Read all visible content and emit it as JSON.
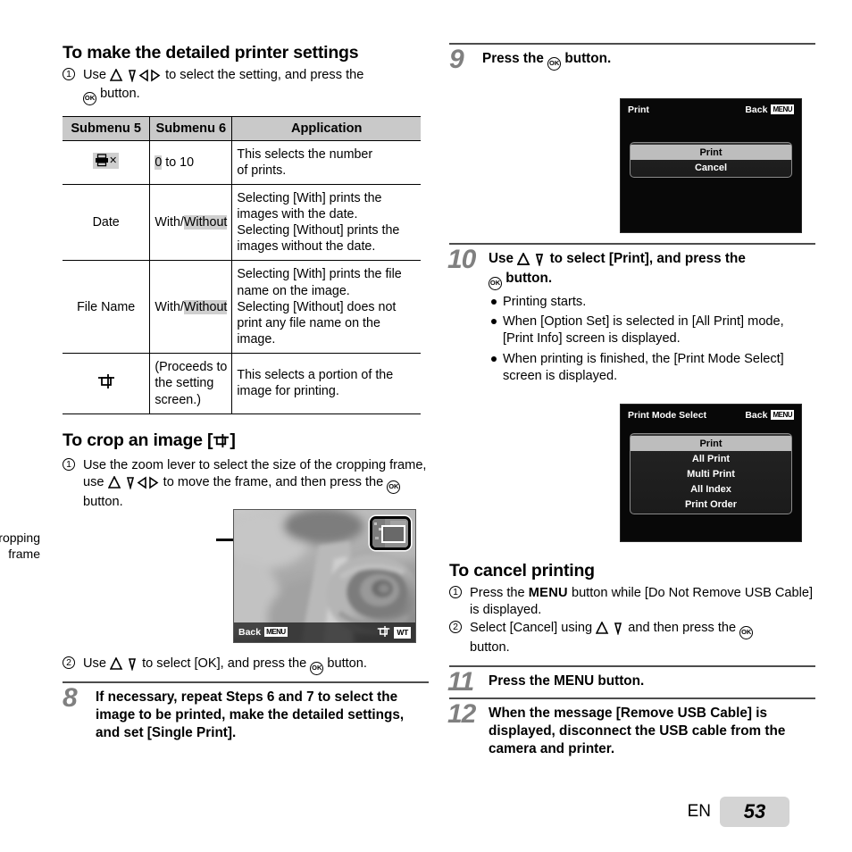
{
  "left": {
    "section1_title": "To make the detailed printer settings",
    "step1": {
      "pre": "Use",
      "post": "to select the setting, and press the",
      "tail": "button."
    },
    "table": {
      "headers": [
        "Submenu 5",
        "Submenu 6",
        "Application"
      ],
      "rows": [
        {
          "submenu5": "×",
          "submenu5_icon": "printer-icon",
          "submenu5_highlight": true,
          "submenu6_pre": "0",
          "submenu6_post": " to 10",
          "submenu6_highlight_part": "0",
          "application": "This selects the number\nof prints."
        },
        {
          "submenu5": "Date",
          "submenu6_pre": "With/",
          "submenu6_post": "Without",
          "submenu6_highlight_part": "Without",
          "application": "Selecting [With] prints the\nimages with the date.\nSelecting [Without] prints the\nimages without the date."
        },
        {
          "submenu5": "File Name",
          "submenu6_pre": "With/",
          "submenu6_post": "Without",
          "submenu6_highlight_part": "Without",
          "application": "Selecting [With] prints the file\nname on the image.\nSelecting [Without] does not\nprint any file name on the\nimage."
        },
        {
          "submenu5": "",
          "submenu5_icon": "crop-icon",
          "submenu6_pre": "(Proceeds to the setting screen.)",
          "submenu6_post": "",
          "submenu6_highlight_part": "",
          "application": "This selects a portion of the\nimage for printing."
        }
      ]
    },
    "section2_title_pre": "To crop an image [",
    "section2_title_post": "]",
    "crop_step1": {
      "pre": "Use the zoom lever to select the size of the cropping frame, use",
      "post": "to move the frame, and then press the",
      "tail": "button."
    },
    "figure": {
      "callout_line1": "Cropping",
      "callout_line2": "frame",
      "photo_back_label": "Back",
      "photo_back_badge": "MENU",
      "photo_wt_badge": "WT"
    },
    "crop_step2": {
      "pre": "Use",
      "post": "to select [OK], and press the",
      "tail": "button."
    },
    "step8": {
      "number": "8",
      "text": "If necessary, repeat Steps 6 and 7 to select the image to be printed, make the detailed settings, and set [Single Print]."
    }
  },
  "right": {
    "step9": {
      "number": "9",
      "pre": "Press the",
      "post": "button."
    },
    "lcd_print": {
      "title": "Print",
      "back_label": "Back",
      "back_badge": "MENU",
      "items": [
        "Print",
        "Cancel"
      ],
      "selected_index": 0
    },
    "step10": {
      "number": "10",
      "pre": "Use",
      "post": "to select [Print], and press the",
      "tail": "button.",
      "bullets": [
        "Printing starts.",
        "When [Option Set] is selected in [All Print] mode, [Print Info] screen is displayed.",
        "When printing is finished, the [Print Mode Select] screen is displayed."
      ]
    },
    "lcd_mode": {
      "title": "Print Mode Select",
      "back_label": "Back",
      "back_badge": "MENU",
      "items": [
        "Print",
        "All Print",
        "Multi Print",
        "All Index",
        "Print Order"
      ],
      "selected_index": 0
    },
    "cancel_title": "To cancel printing",
    "cancel_step1": {
      "pre": "Press the",
      "menu": "MENU",
      "post": "button while [Do Not Remove USB Cable]  is displayed."
    },
    "cancel_step2": {
      "pre": "Select [Cancel] using",
      "post": "and then press the",
      "tail": "button."
    },
    "step11": {
      "number": "11",
      "pre": "Press the",
      "menu": "MENU",
      "post": "button."
    },
    "step12": {
      "number": "12",
      "text": "When the message [Remove USB Cable] is displayed, disconnect the USB cable from the camera and printer."
    }
  },
  "footer": {
    "lang": "EN",
    "page": "53"
  },
  "colors": {
    "table_header_bg": "#c9c9c9",
    "highlight_bg": "#cfcfcf",
    "step_number": "#808080",
    "rule": "#4d4d4d",
    "page_badge_bg": "#d4d4d4"
  }
}
